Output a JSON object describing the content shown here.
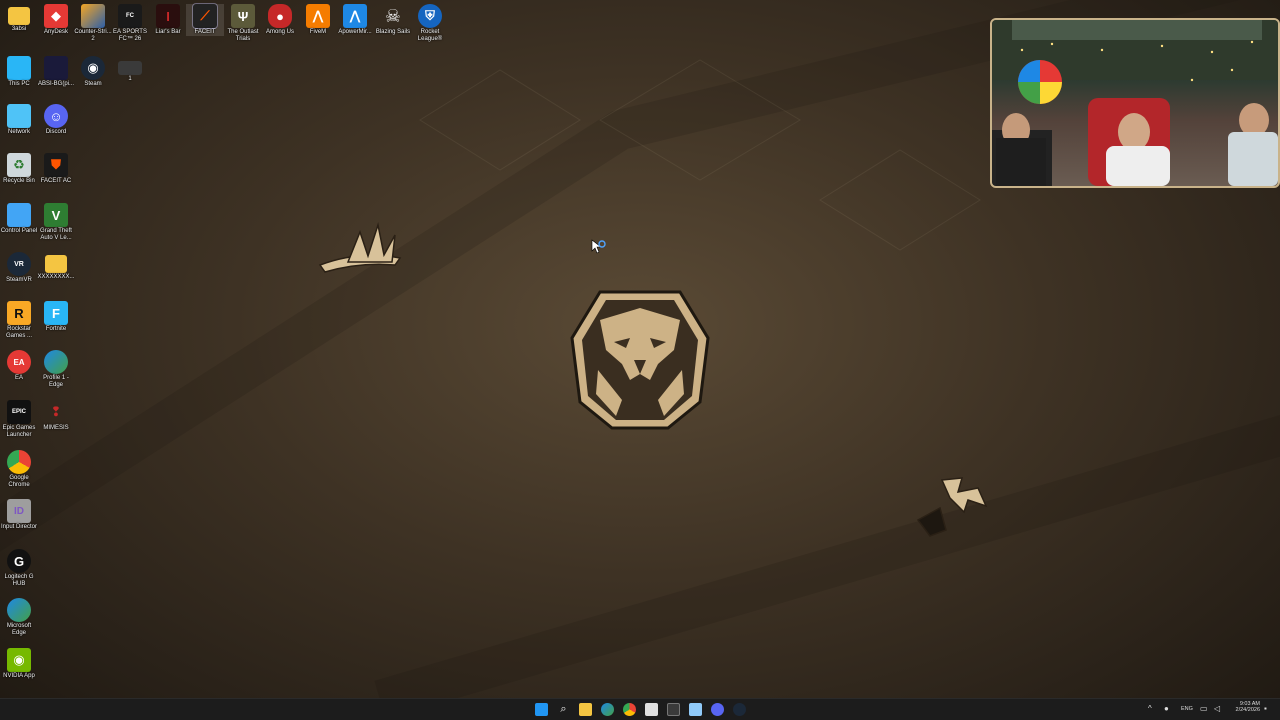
{
  "desktop": {
    "icons": [
      {
        "label": "3absi",
        "icon": "folder-icon",
        "color": "#f4c542"
      },
      {
        "label": "AnyDesk",
        "icon": "anydesk-icon",
        "color": "#e53935"
      },
      {
        "label": "Counter-Stri... 2",
        "icon": "cs2-icon",
        "color": "#2d5fa8"
      },
      {
        "label": "EA SPORTS FC™ 26",
        "icon": "easports-icon",
        "color": "#1a1a1a"
      },
      {
        "label": "Liar's Bar",
        "icon": "liars-bar-icon",
        "color": "#3a1010"
      },
      {
        "label": "FACEIT",
        "icon": "faceit-icon",
        "color": "#222222"
      },
      {
        "label": "The Outlast Trials",
        "icon": "outlast-icon",
        "color": "#5c5a3a"
      },
      {
        "label": "Among Us",
        "icon": "among-us-icon",
        "color": "#c62828"
      },
      {
        "label": "FiveM",
        "icon": "fivem-icon",
        "color": "#f57c00"
      },
      {
        "label": "ApowerMir...",
        "icon": "apowermirror-icon",
        "color": "#1e88e5"
      },
      {
        "label": "Blazing Sails",
        "icon": "blazing-sails-icon",
        "color": "#e0e0e0"
      },
      {
        "label": "Rocket League®",
        "icon": "rocket-league-icon",
        "color": "#1565c0"
      },
      {
        "label": "This PC",
        "icon": "this-pc-icon",
        "color": "#29b6f6"
      },
      {
        "label": "ABSI-BG(pi...",
        "icon": "image-file-icon",
        "color": "#1a1a3a"
      },
      {
        "label": "Steam",
        "icon": "steam-icon",
        "color": "#1b2838"
      },
      {
        "label": "1",
        "icon": "image-file-icon",
        "color": "#3a3a3a"
      },
      {
        "label": "Network",
        "icon": "network-icon",
        "color": "#4fc3f7"
      },
      {
        "label": "Discord",
        "icon": "discord-icon",
        "color": "#5865f2"
      },
      {
        "label": "Recycle Bin",
        "icon": "recycle-bin-icon",
        "color": "#90a4ae"
      },
      {
        "label": "FACEIT AC",
        "icon": "faceit-ac-icon",
        "color": "#1a1a1a"
      },
      {
        "label": "Control Panel",
        "icon": "control-panel-icon",
        "color": "#42a5f5"
      },
      {
        "label": "Grand Theft Auto V Le...",
        "icon": "gta-icon",
        "color": "#2e7d32"
      },
      {
        "label": "SteamVR",
        "icon": "steamvr-icon",
        "color": "#1b2838"
      },
      {
        "label": "XXXXXXXX...",
        "icon": "folder-icon",
        "color": "#f4c542"
      },
      {
        "label": "Rockstar Games ...",
        "icon": "rockstar-icon",
        "color": "#f9a825"
      },
      {
        "label": "Fortnite",
        "icon": "fortnite-icon",
        "color": "#29b6f6"
      },
      {
        "label": "EA",
        "icon": "ea-icon",
        "color": "#e53935"
      },
      {
        "label": "Profile 1 - Edge",
        "icon": "edge-icon",
        "color": "#1e88e5"
      },
      {
        "label": "Epic Games Launcher",
        "icon": "epic-icon",
        "color": "#111111"
      },
      {
        "label": "MIMESIS",
        "icon": "mimesis-icon",
        "color": "#c62828"
      },
      {
        "label": "Google Chrome",
        "icon": "chrome-icon",
        "color": "#4285f4"
      },
      {
        "label": "Input Director",
        "icon": "input-director-icon",
        "color": "#9e9e9e"
      },
      {
        "label": "Logitech G HUB",
        "icon": "logitech-icon",
        "color": "#111111"
      },
      {
        "label": "Microsoft Edge",
        "icon": "edge-icon",
        "color": "#1e88e5"
      },
      {
        "label": "NVIDIA App",
        "icon": "nvidia-icon",
        "color": "#76b900"
      }
    ]
  },
  "taskbar": {
    "tray": {
      "language": "ENG",
      "time": "9:03 AM",
      "date": "2/24/2026"
    }
  }
}
